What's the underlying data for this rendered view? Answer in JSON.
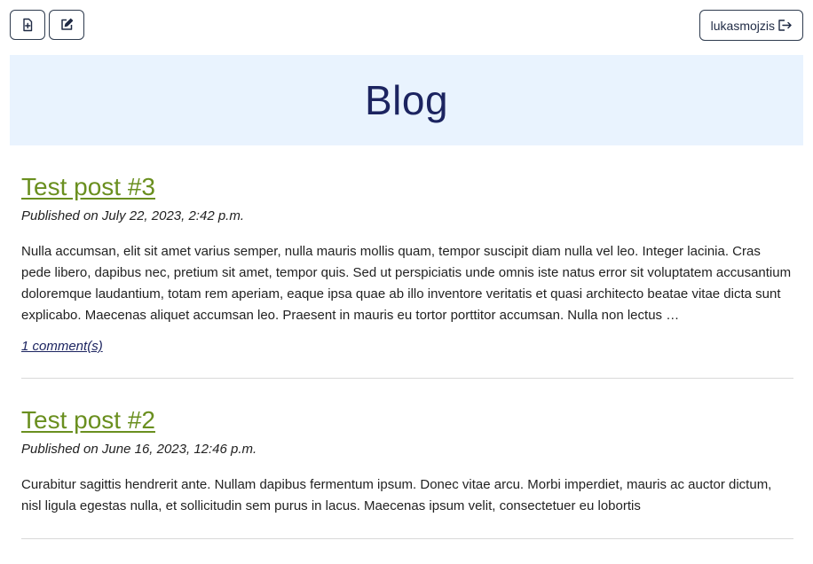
{
  "toolbar": {
    "new_post_icon": "file-plus-icon",
    "edit_icon": "edit-icon",
    "username": "lukasmojzis",
    "logout_icon": "logout-icon"
  },
  "banner": {
    "title": "Blog"
  },
  "posts": [
    {
      "title": "Test post #3",
      "published": "Published on July 22, 2023, 2:42 p.m.",
      "excerpt": "Nulla accumsan, elit sit amet varius semper, nulla mauris mollis quam, tempor suscipit diam nulla vel leo. Integer lacinia. Cras pede libero, dapibus nec, pretium sit amet, tempor quis. Sed ut perspiciatis unde omnis iste natus error sit voluptatem accusantium doloremque laudantium, totam rem aperiam, eaque ipsa quae ab illo inventore veritatis et quasi architecto beatae vitae dicta sunt explicabo. Maecenas aliquet accumsan leo. Praesent in mauris eu tortor porttitor accumsan. Nulla non lectus …",
      "comments": "1 comment(s)"
    },
    {
      "title": "Test post #2",
      "published": "Published on June 16, 2023, 12:46 p.m.",
      "excerpt": "Curabitur sagittis hendrerit ante. Nullam dapibus fermentum ipsum. Donec vitae arcu. Morbi imperdiet, mauris ac auctor dictum, nisl ligula egestas nulla, et sollicitudin sem purus in lacus. Maecenas ipsum velit, consectetuer eu lobortis"
    }
  ]
}
